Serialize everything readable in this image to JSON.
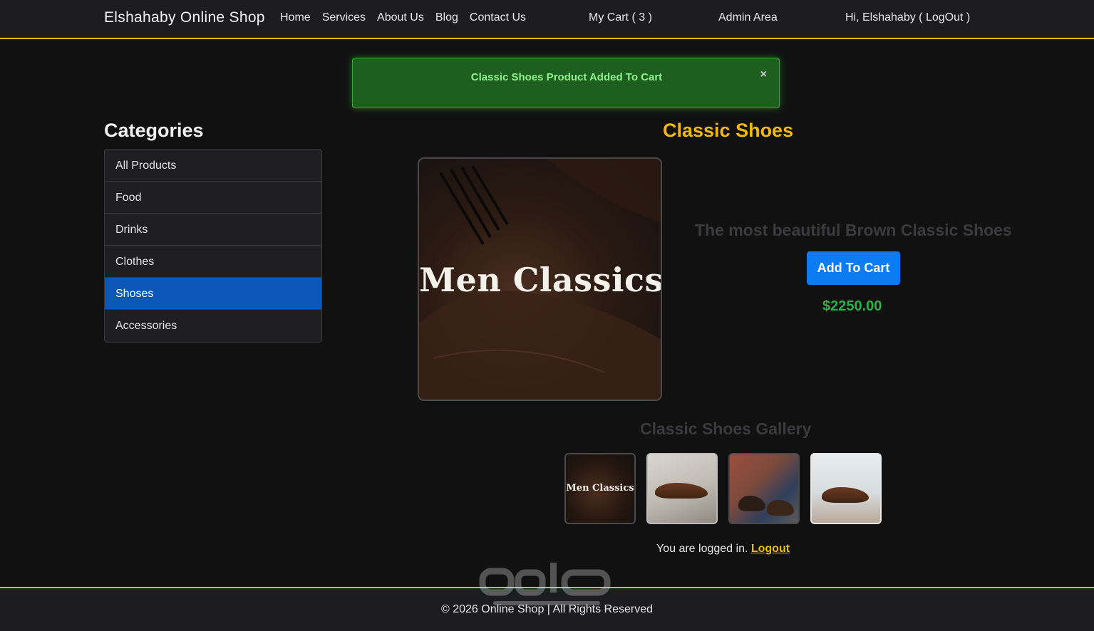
{
  "navbar": {
    "brand": "Elshahaby Online Shop",
    "links": [
      "Home",
      "Services",
      "About Us",
      "Blog",
      "Contact Us"
    ],
    "cart": "My Cart ( 3 )",
    "admin": "Admin Area",
    "user": "Hi, Elshahaby ( LogOut )"
  },
  "alert": {
    "message": "Classic Shoes Product Added To Cart",
    "close": "×"
  },
  "categories": {
    "title": "Categories",
    "items": [
      "All Products",
      "Food",
      "Drinks",
      "Clothes",
      "Shoses",
      "Accessories"
    ],
    "active": "Shoses"
  },
  "product": {
    "title": "Classic Shoes",
    "image_text": "Men Classics",
    "description": "The most beautiful Brown Classic Shoes",
    "add_button": "Add To Cart",
    "price": "$2250.00"
  },
  "gallery": {
    "title": "Classic Shoes Gallery",
    "thumb1_text": "Men Classics"
  },
  "status": {
    "logged_text": "You are logged in.",
    "logout_link": "Logout"
  },
  "footer": {
    "text": "© 2026 Online Shop | All Rights Reserved"
  },
  "colors": {
    "accent": "#f0b90b",
    "active_category": "#0a57b8",
    "button": "#0d7cf2",
    "price": "#2bb24a",
    "alert_bg": "#1e5e1f"
  }
}
